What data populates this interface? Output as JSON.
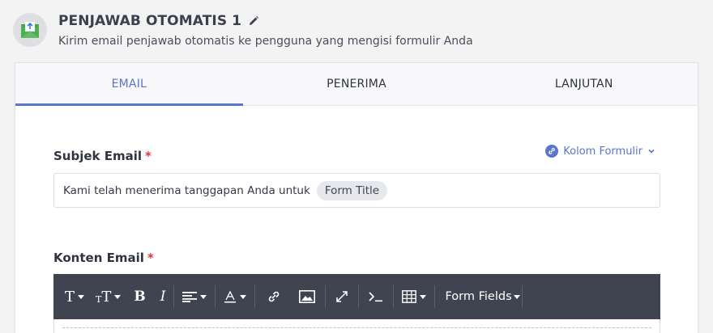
{
  "header": {
    "title": "PENJAWAB OTOMATIS 1",
    "description": "Kirim email penjawab otomatis ke pengguna yang mengisi formulir Anda"
  },
  "tabs": [
    {
      "label": "EMAIL",
      "active": true
    },
    {
      "label": "PENERIMA",
      "active": false
    },
    {
      "label": "LANJUTAN",
      "active": false
    }
  ],
  "subject": {
    "label": "Subjek Email",
    "required_mark": "*",
    "value_text": "Kami telah menerima tanggapan Anda untuk",
    "tag": "Form Title"
  },
  "form_fields_link": {
    "label": "Kolom Formulir"
  },
  "content": {
    "label": "Konten Email",
    "required_mark": "*"
  },
  "toolbar": {
    "text_icon": "T",
    "text_size_icon": "T",
    "bold": "B",
    "italic": "I",
    "form_fields": "Form Fields"
  },
  "colors": {
    "accent": "#5b74cc",
    "toolbar_bg": "#3f4450",
    "required": "#d6394a"
  }
}
